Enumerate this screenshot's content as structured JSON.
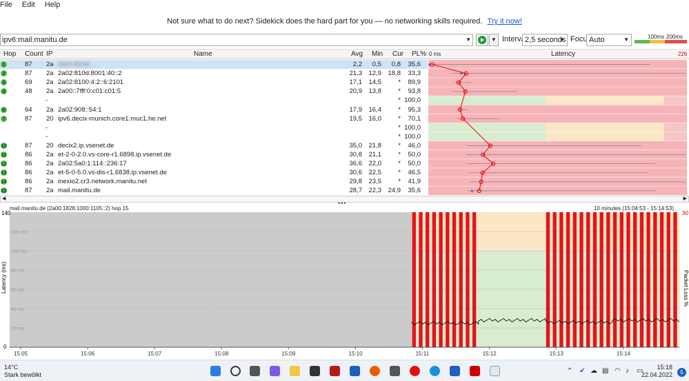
{
  "menu": [
    "File",
    "Edit",
    "Help"
  ],
  "banner": {
    "text": "Not sure what to do next? Sidekick does the hard part for you — no networking skills required.",
    "link": "Try it now!"
  },
  "toolbar": {
    "address": "ipv6:mail.manitu.de",
    "interval_label": "Interval",
    "interval_value": "2,5 seconds",
    "focus_label": "Focus",
    "focus_value": "Auto",
    "legend_100": "100ms",
    "legend_200": "200ms",
    "colors": {
      "green": "#5cb85c",
      "yellow": "#f0c040",
      "red": "#e04a4a"
    }
  },
  "table": {
    "headers": {
      "hop": "Hop",
      "count": "Count",
      "ip": "IP",
      "name": "Name",
      "avg": "Avg",
      "min": "Min",
      "cur": "Cur",
      "pl": "PL%",
      "zero": "0 ms",
      "latency": "Latency",
      "max": "226"
    },
    "rows": [
      {
        "hop": "1",
        "count": "87",
        "ip": "2a",
        "name": "2a02:810d:...",
        "avg": "2,2",
        "min": "0,5",
        "cur": "0,8",
        "pl": "35,6",
        "avg_ms": 2.2,
        "min_ms": 0.5,
        "cur_ms": 0.8,
        "max_ms": 125,
        "blurred": true
      },
      {
        "hop": "2",
        "count": "87",
        "ip": "2a",
        "name": "2a02:810d:8001:40::2",
        "avg": "21,3",
        "min": "12,9",
        "cur": "18,8",
        "pl": "33,3",
        "avg_ms": 21.3,
        "min_ms": 12.9,
        "cur_ms": 18.8,
        "max_ms": 158
      },
      {
        "hop": "3",
        "count": "69",
        "ip": "2a",
        "name": "2a02:8100:4:2::6:2101",
        "avg": "17,1",
        "min": "14,5",
        "cur": "*",
        "pl": "89,9",
        "avg_ms": 17.1,
        "min_ms": 14.5,
        "max_ms": 24
      },
      {
        "hop": "4",
        "count": "48",
        "ip": "2a",
        "name": "2a00::7fff:0:c01:c01:5",
        "avg": "20,9",
        "min": "13,8",
        "cur": "*",
        "pl": "93,8",
        "avg_ms": 20.9,
        "min_ms": 13.8,
        "max_ms": 50
      },
      {
        "hop": "",
        "count": "",
        "ip": "",
        "name": "-",
        "avg": "",
        "min": "",
        "cur": "*",
        "pl": "100,0"
      },
      {
        "hop": "6",
        "count": "64",
        "ip": "2a",
        "name": "2a02:908::54:1",
        "avg": "17,9",
        "min": "16,4",
        "cur": "*",
        "pl": "95,3",
        "avg_ms": 17.9,
        "min_ms": 16.4,
        "max_ms": 22
      },
      {
        "hop": "7",
        "count": "87",
        "ip": "20",
        "name": "ipv6.decix-munich.core1.muc1.he.net",
        "avg": "19,5",
        "min": "16,0",
        "cur": "*",
        "pl": "70,1",
        "avg_ms": 19.5,
        "min_ms": 16.0,
        "max_ms": 40
      },
      {
        "hop": "",
        "count": "",
        "ip": "",
        "name": "-",
        "avg": "",
        "min": "",
        "cur": "*",
        "pl": "100,0"
      },
      {
        "hop": "",
        "count": "",
        "ip": "",
        "name": "-",
        "avg": "",
        "min": "",
        "cur": "*",
        "pl": "100,0"
      },
      {
        "hop": "10",
        "count": "87",
        "ip": "20",
        "name": "decix2.ip.vsenet.de",
        "avg": "35,0",
        "min": "21,8",
        "cur": "*",
        "pl": "46,0",
        "avg_ms": 35.0,
        "min_ms": 21.8,
        "max_ms": 120
      },
      {
        "hop": "11",
        "count": "86",
        "ip": "2a",
        "name": "et-2-0-2.0.vs-core-r1.6898.ip.vsenet.de",
        "avg": "30,8",
        "min": "21,1",
        "cur": "*",
        "pl": "50,0",
        "avg_ms": 30.8,
        "min_ms": 21.1,
        "max_ms": 180
      },
      {
        "hop": "12",
        "count": "86",
        "ip": "2a",
        "name": "2a02:5a0:1:114::236:17",
        "avg": "36,6",
        "min": "22,0",
        "cur": "*",
        "pl": "50,0",
        "avg_ms": 36.6,
        "min_ms": 22.0,
        "max_ms": 128
      },
      {
        "hop": "13",
        "count": "86",
        "ip": "2a",
        "name": "et-5-0-5.0.vs-dis-r1.6838.ip.vsenet.de",
        "avg": "30,6",
        "min": "22,5",
        "cur": "*",
        "pl": "46,5",
        "avg_ms": 30.6,
        "min_ms": 22.5,
        "max_ms": 124
      },
      {
        "hop": "14",
        "count": "86",
        "ip": "2a",
        "name": "inexio2.cr3.network.manitu.net",
        "avg": "29,8",
        "min": "23,5",
        "cur": "*",
        "pl": "41,9",
        "avg_ms": 29.8,
        "min_ms": 23.5,
        "max_ms": 180
      },
      {
        "hop": "15",
        "count": "87",
        "ip": "2a",
        "name": "mail.manitu.de",
        "avg": "28,7",
        "min": "22,3",
        "cur": "24,9",
        "pl": "35,6",
        "avg_ms": 28.7,
        "min_ms": 22.3,
        "cur_ms": 24.9,
        "max_ms": 128
      }
    ]
  },
  "graph": {
    "title": "mail.manitu.de (2a00:1828:1000:1105::2) hop 15",
    "range": "10 minutes (15:04:53 - 15:14:53)",
    "y_max": "140",
    "y_zero": "0",
    "y_ticks": [
      "120 ms",
      "100 ms",
      "80 ms",
      "60 ms",
      "40 ms",
      "20 ms"
    ],
    "ylabel": "Latency (ms)",
    "right_max": "30",
    "right_label": "Packet Loss %",
    "x_ticks": [
      "15:05",
      "15:06",
      "15:07",
      "15:08",
      "15:09",
      "15:10",
      "15:11",
      "15:12",
      "15:13",
      "15:14"
    ]
  },
  "chart_data": {
    "type": "bar",
    "title": "mail.manitu.de (2a00:1828:1000:1105::2) hop 15",
    "xlabel": "",
    "ylabel": "Latency (ms)",
    "ylim": [
      0,
      140
    ],
    "y2label": "Packet Loss %",
    "y2lim": [
      0,
      30
    ],
    "categories": [
      "15:05",
      "15:06",
      "15:07",
      "15:08",
      "15:09",
      "15:10",
      "15:11",
      "15:12",
      "15:13",
      "15:14"
    ],
    "series": [
      {
        "name": "Latency (ms)",
        "values": [
          null,
          null,
          null,
          null,
          null,
          null,
          25,
          28,
          26,
          28
        ]
      },
      {
        "name": "Packet Loss %",
        "values": [
          null,
          null,
          null,
          null,
          null,
          null,
          30,
          0,
          30,
          30
        ]
      }
    ]
  },
  "taskbar": {
    "temp": "14°C",
    "weather": "Stark bewölkt",
    "time": "15:18",
    "date": "22.04.2022",
    "notifications": "5"
  }
}
